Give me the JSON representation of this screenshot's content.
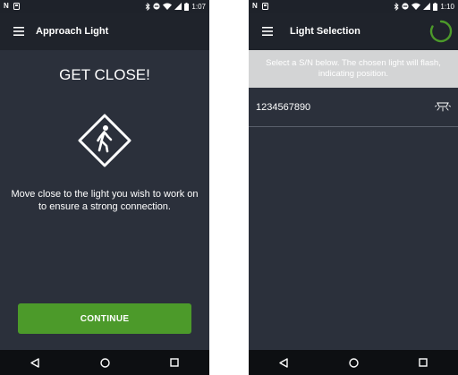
{
  "left_screen": {
    "status_bar": {
      "time": "1:07",
      "left_glyph": "N",
      "icons": [
        "bluetooth-icon",
        "minus-circle-icon",
        "wifi-icon",
        "signal-icon",
        "battery-icon"
      ]
    },
    "app_bar": {
      "title": "Approach Light",
      "menu_icon": "hamburger-menu-icon"
    },
    "headline": "GET CLOSE!",
    "sign_icon": "pedestrian-crossing-sign-icon",
    "instructions": "Move close to the light you wish to work on to ensure a strong connection.",
    "continue_label": "CONTINUE",
    "colors": {
      "accent": "#4c9a2a",
      "background": "#2b303b"
    }
  },
  "right_screen": {
    "status_bar": {
      "time": "1:10",
      "left_glyph": "N",
      "icons": [
        "bluetooth-icon",
        "minus-circle-icon",
        "wifi-icon",
        "signal-icon",
        "battery-icon"
      ]
    },
    "app_bar": {
      "title": "Light Selection",
      "menu_icon": "hamburger-menu-icon",
      "spinner_icon": "loading-spinner-icon"
    },
    "banner": "Select a S/N below. The chosen light will flash, indicating position.",
    "lights": [
      {
        "serial": "1234567890",
        "icon": "ceiling-light-icon"
      }
    ],
    "colors": {
      "accent": "#4c9a2a",
      "banner": "#d3d4d5"
    }
  },
  "nav_bar": {
    "icons": [
      "back-icon",
      "home-icon",
      "recents-icon"
    ]
  }
}
